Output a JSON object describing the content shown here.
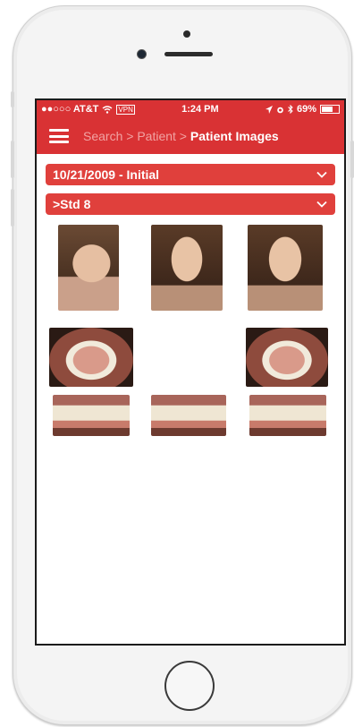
{
  "status_bar": {
    "carrier": "●●○○○ AT&T",
    "wifi_icon": "wifi-icon",
    "vpn": "VPN",
    "time": "1:24 PM",
    "battery_percent": "69%",
    "battery_level": 0.69
  },
  "nav": {
    "breadcrumb_search": "Search",
    "sep1": " > ",
    "breadcrumb_patient": "Patient",
    "sep2": " > ",
    "breadcrumb_current": "Patient Images"
  },
  "visit_select": {
    "value": "10/21/2009 - Initial"
  },
  "set_select": {
    "value": ">Std 8"
  },
  "images": [
    {
      "name": "profile-photo"
    },
    {
      "name": "frontal-photo"
    },
    {
      "name": "smile-photo"
    },
    {
      "name": "upper-occlusal-photo"
    },
    {
      "name": "lower-occlusal-photo"
    },
    {
      "name": "right-buccal-photo"
    },
    {
      "name": "frontal-intraoral-photo"
    },
    {
      "name": "left-buccal-photo"
    }
  ]
}
